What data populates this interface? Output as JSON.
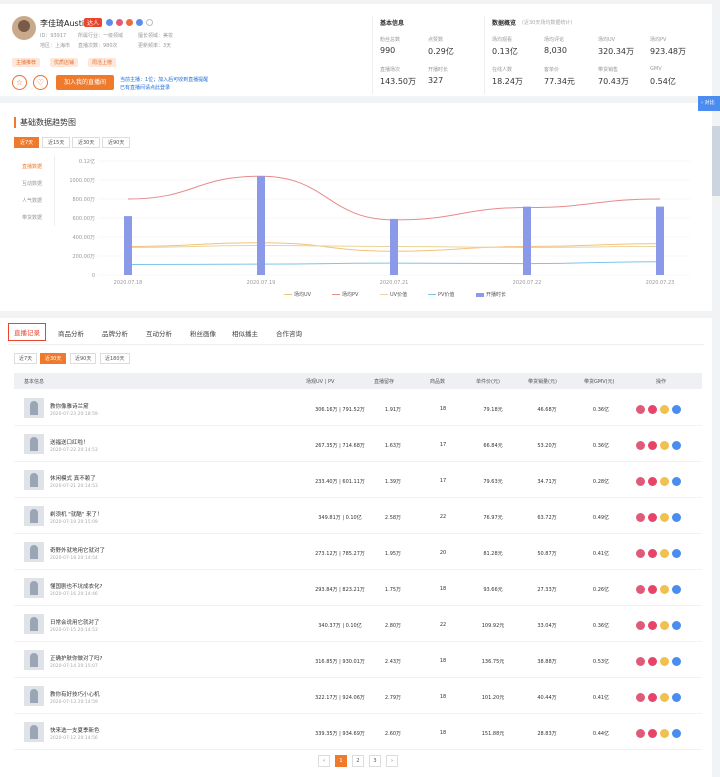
{
  "profile": {
    "name": "李佳琦Austin",
    "vtag": "达人",
    "meta": [
      {
        "label": "ID：93917",
        "x": 40,
        "y": 28
      },
      {
        "label": "所属行业：一级领域",
        "x": 78,
        "y": 28
      },
      {
        "label": "擅长领域：美妆",
        "x": 138,
        "y": 28
      },
      {
        "label": "地区：上海市",
        "x": 40,
        "y": 38
      },
      {
        "label": "直播次数：980次",
        "x": 78,
        "y": 38
      },
      {
        "label": "更新频率：3天",
        "x": 138,
        "y": 38
      }
    ],
    "tags": [
      "主播推荐",
      "优质店铺",
      "周活上榜"
    ],
    "circle_icons": [
      "star-icon",
      "heart-icon"
    ],
    "join_label": "加入我的直播间",
    "join_note_1": "当前主播：1位；加入后可收到直播提醒",
    "join_note_2": "已有直播间请点此登录"
  },
  "basic": {
    "title": "基本信息",
    "stats": [
      {
        "label": "粉丝总数",
        "value": "990"
      },
      {
        "label": "点赞数",
        "value": "0.29亿"
      },
      {
        "label": "直播场次",
        "value": "143.50万"
      },
      {
        "label": "开播时长",
        "value": "327"
      }
    ]
  },
  "overview": {
    "title": "数据概览",
    "subtitle": "(近30天场均数据统计)",
    "stats": [
      {
        "label": "场均观看",
        "value": "0.13亿"
      },
      {
        "label": "场均评论",
        "value": "8,030"
      },
      {
        "label": "场均UV",
        "value": "320.34万"
      },
      {
        "label": "场均PV",
        "value": "923.48万"
      },
      {
        "label": "在线人数",
        "value": "18.24万"
      },
      {
        "label": "客单价",
        "value": "77.34元"
      },
      {
        "label": "带货销售",
        "value": "70.43万"
      },
      {
        "label": "GMV",
        "value": "0.54亿"
      }
    ]
  },
  "trend": {
    "title": "基础数据趋势图",
    "periods": [
      "近7天",
      "近15天",
      "近30天",
      "近90天"
    ],
    "metrics": [
      "直播数据",
      "互动数据",
      "人气数据",
      "带货数据"
    ],
    "side_button": "‹ 对比"
  },
  "chart_data": {
    "type": "line",
    "categories": [
      "2020.07.18",
      "2020.07.19",
      "2020.07.21",
      "2020.07.22",
      "2020.07.23"
    ],
    "yticks": [
      "0",
      "200.00万",
      "400.00万",
      "600.00万",
      "800.00万",
      "1000.00万",
      "0.12亿"
    ],
    "ylim": [
      0,
      1200
    ],
    "series": [
      {
        "name": "场均UV",
        "type": "line",
        "color": "#f5c07a",
        "values": [
          300,
          340,
          250,
          300,
          330
        ]
      },
      {
        "name": "场均PV",
        "type": "line",
        "color": "#e88a8a",
        "values": [
          800,
          1040,
          580,
          710,
          800
        ]
      },
      {
        "name": "UV价值",
        "type": "line",
        "color": "#e8d49a",
        "values": [
          290,
          310,
          300,
          290,
          300
        ]
      },
      {
        "name": "PV价值",
        "type": "line",
        "color": "#7ec4e8",
        "values": [
          110,
          115,
          125,
          120,
          140
        ]
      },
      {
        "name": "开播时长",
        "type": "bar",
        "color": "#8a9ae8",
        "values": [
          620,
          1040,
          590,
          720,
          720
        ]
      }
    ],
    "legend_position": "bottom"
  },
  "list": {
    "tabs": [
      "直播记录",
      "商品分析",
      "品牌分析",
      "互动分析",
      "粉丝画像",
      "相似播主",
      "合作咨询"
    ],
    "ranges": [
      "近7天",
      "近30天",
      "近90天",
      "近180天"
    ],
    "headers": [
      "基本信息",
      "场观UV | PV",
      "直播留存",
      "商品数",
      "单件价(元)",
      "带货销量(元)",
      "带货GMV(元)",
      "操作"
    ],
    "rows": [
      {
        "title": "教你像雅诗兰黛",
        "date": "2020-07-23 20:18:59",
        "uvpv": "306.16万 | 791.52万",
        "ret": "1.91万",
        "goods": "18",
        "price": "79.18元",
        "sales": "46.68万",
        "gmv": "0.36亿"
      },
      {
        "title": "送福送口红啦！",
        "date": "2020-07-22 20:14:53",
        "uvpv": "267.35万 | 714.68万",
        "ret": "1.63万",
        "goods": "17",
        "price": "66.84元",
        "sales": "53.20万",
        "gmv": "0.36亿"
      },
      {
        "title": "休闲模式 真不赖了",
        "date": "2020-07-21 20:14:53",
        "uvpv": "233.40万 | 601.11万",
        "ret": "1.39万",
        "goods": "17",
        "price": "79.63元",
        "sales": "34.71万",
        "gmv": "0.28亿"
      },
      {
        "title": "剃须机 \"就酷\" 来了！",
        "date": "2020-07-19 20:15:09",
        "uvpv": "349.81万 | 0.10亿",
        "ret": "2.58万",
        "goods": "22",
        "price": "76.97元",
        "sales": "63.72万",
        "gmv": "0.49亿"
      },
      {
        "title": "奇野外就地用它就对了",
        "date": "2020-07-18 20:14:54",
        "uvpv": "273.12万 | 785.27万",
        "ret": "1.95万",
        "goods": "20",
        "price": "81.28元",
        "sales": "50.87万",
        "gmv": "0.41亿"
      },
      {
        "title": "懂国剧也不坑成衣化?",
        "date": "2020-07-16 20:14:46",
        "uvpv": "293.84万 | 823.21万",
        "ret": "1.75万",
        "goods": "18",
        "price": "93.66元",
        "sales": "27.33万",
        "gmv": "0.26亿"
      },
      {
        "title": "日常会说用它就对了",
        "date": "2020-07-15 20:14:53",
        "uvpv": "340.37万 | 0.10亿",
        "ret": "2.80万",
        "goods": "22",
        "price": "109.92元",
        "sales": "33.04万",
        "gmv": "0.36亿"
      },
      {
        "title": "正确护肤你做对了吗?",
        "date": "2020-07-14 20:15:07",
        "uvpv": "316.85万 | 930.01万",
        "ret": "2.43万",
        "goods": "18",
        "price": "136.75元",
        "sales": "38.88万",
        "gmv": "0.53亿"
      },
      {
        "title": "教你有好技巧小心机",
        "date": "2020-07-13 20:14:59",
        "uvpv": "322.17万 | 924.06万",
        "ret": "2.79万",
        "goods": "18",
        "price": "101.20元",
        "sales": "40.44万",
        "gmv": "0.41亿"
      },
      {
        "title": "快来选一支夏季新色",
        "date": "2020-07-12 20:14:56",
        "uvpv": "339.35万 | 934.69万",
        "ret": "2.60万",
        "goods": "18",
        "price": "151.88元",
        "sales": "28.83万",
        "gmv": "0.44亿"
      }
    ],
    "op_colors": [
      "#e05a7a",
      "#e8446a",
      "#f0c050",
      "#4a8cf0"
    ],
    "op_icons": [
      "play-icon",
      "star-icon",
      "more-icon",
      "detail-icon"
    ],
    "pages": [
      "‹",
      "1",
      "2",
      "3",
      "›"
    ]
  }
}
